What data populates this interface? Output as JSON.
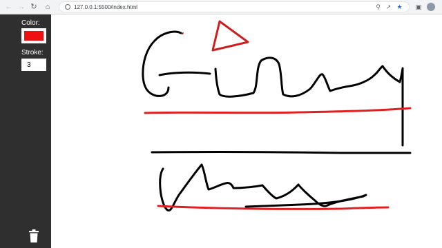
{
  "browser": {
    "url": "127.0.0.1:5500/index.html",
    "nav": {
      "back_icon": "arrow-left-icon",
      "forward_icon": "arrow-right-icon",
      "reload_icon": "reload-icon",
      "home_icon": "home-icon"
    },
    "omnibox_icons": [
      "zoom-icon",
      "share-icon",
      "bookmark-star-icon"
    ],
    "extension_icons": [
      "extension-icon",
      "extension-icon"
    ],
    "accent_color": "#1a73e8"
  },
  "sidebar": {
    "color_label": "Color:",
    "color_value": "#ee1111",
    "stroke_label": "Stroke:",
    "stroke_value": "3",
    "clear_icon": "trash-icon"
  },
  "canvas": {
    "background": "#ffffff",
    "stroke_colors": [
      "#000000",
      "#e02020",
      "#cc1f1f"
    ]
  }
}
